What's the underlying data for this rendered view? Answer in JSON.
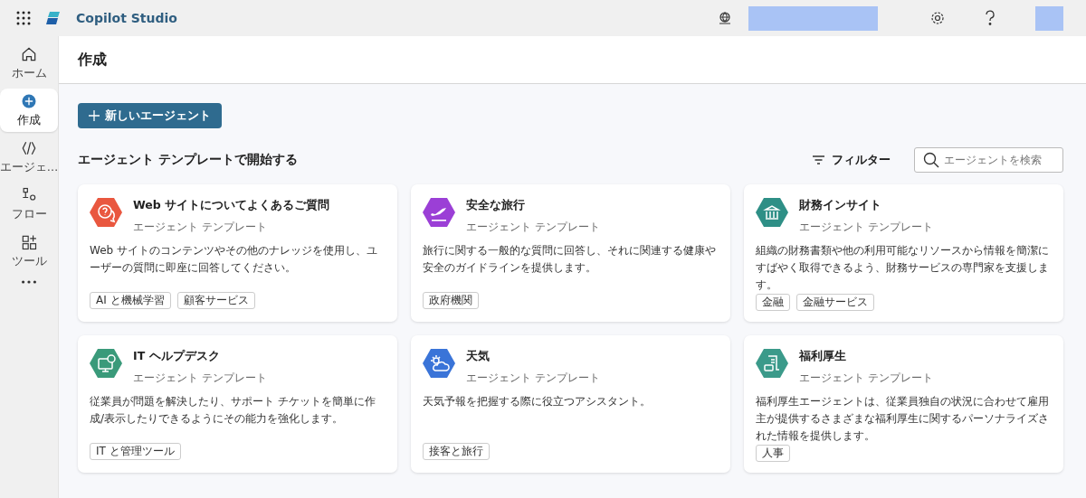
{
  "app": {
    "title": "Copilot Studio"
  },
  "sidebar": {
    "items": [
      {
        "label": "ホーム",
        "kind": "home",
        "selected": false
      },
      {
        "label": "作成",
        "kind": "plus",
        "selected": true
      },
      {
        "label": "エージェ…",
        "kind": "agent",
        "selected": false
      },
      {
        "label": "フロー",
        "kind": "flow",
        "selected": false
      },
      {
        "label": "ツール",
        "kind": "tools",
        "selected": false
      },
      {
        "kind": "more",
        "selected": false
      }
    ]
  },
  "page": {
    "title": "作成",
    "new_button": "新しいエージェント",
    "section_title": "エージェント テンプレートで開始する",
    "filter": "フィルター",
    "search": {
      "placeholder": "エージェントを検索"
    }
  },
  "templates": [
    {
      "title": "Web サイトについてよくあるご質問",
      "subtitle": "エージェント テンプレート",
      "description": "Web サイトのコンテンツやその他のナレッジを使用し、ユーザーの質問に即座に回答してください。",
      "tags": [
        "AI と機械学習",
        "顧客サービス"
      ],
      "kind": "chat",
      "color": "#e9573f"
    },
    {
      "title": "安全な旅行",
      "subtitle": "エージェント テンプレート",
      "description": "旅行に関する一般的な質問に回答し、それに関連する健康や安全のガイドラインを提供します。",
      "tags": [
        "政府機関"
      ],
      "kind": "plane",
      "color": "#9b3fd6"
    },
    {
      "title": "財務インサイト",
      "subtitle": "エージェント テンプレート",
      "description": "組織の財務書類や他の利用可能なリソースから情報を簡潔にすばやく取得できるよう、財務サービスの専門家を支援します。",
      "tags": [
        "金融",
        "金融サービス"
      ],
      "kind": "bank",
      "color": "#2e8f86"
    },
    {
      "title": "IT ヘルプデスク",
      "subtitle": "エージェント テンプレート",
      "description": "従業員が問題を解決したり、サポート チケットを簡単に作成/表示したりできるようにその能力を強化します。",
      "tags": [
        "IT と管理ツール"
      ],
      "kind": "monitor",
      "color": "#3a9a7a"
    },
    {
      "title": "天気",
      "subtitle": "エージェント テンプレート",
      "description": "天気予報を把握する際に役立つアシスタント。",
      "tags": [
        "接客と旅行"
      ],
      "kind": "weather",
      "color": "#3a74d8"
    },
    {
      "title": "福利厚生",
      "subtitle": "エージェント テンプレート",
      "description": "福利厚生エージェントは、従業員独自の状況に合わせて雇用主が提供するさまざまな福利厚生に関するパーソナライズされた情報を提供します。",
      "tags": [
        "人事"
      ],
      "kind": "document",
      "color": "#3b9a8a"
    }
  ]
}
